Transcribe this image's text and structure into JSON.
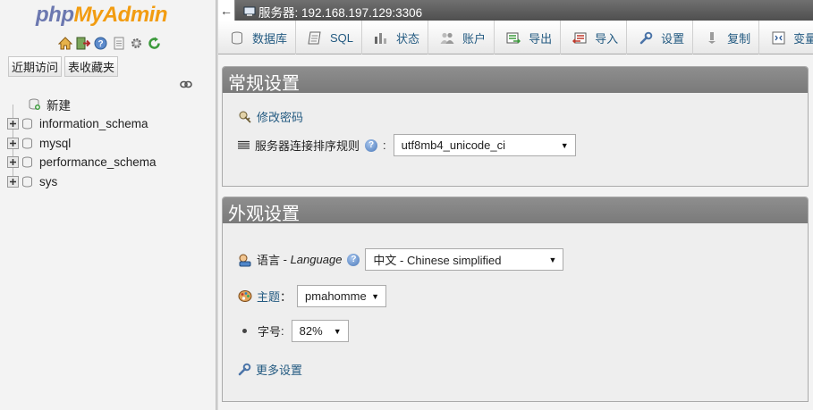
{
  "app": {
    "logo_php": "php",
    "logo_myadmin": "MyAdmin",
    "nav_icons": [
      "home-icon",
      "exit-icon",
      "help-icon",
      "docs-icon",
      "settings-icon",
      "reload-icon"
    ],
    "buttons": {
      "recent": "近期访问",
      "favorites": "表收藏夹"
    },
    "tree": [
      {
        "label": "新建",
        "kind": "new"
      },
      {
        "label": "information_schema",
        "kind": "db"
      },
      {
        "label": "mysql",
        "kind": "db"
      },
      {
        "label": "performance_schema",
        "kind": "db"
      },
      {
        "label": "sys",
        "kind": "db"
      }
    ]
  },
  "topbar": {
    "back": "←",
    "server_label": "服务器: 192.168.197.129:3306"
  },
  "tabs": [
    {
      "label": "数据库",
      "icon": "database-icon"
    },
    {
      "label": "SQL",
      "icon": "sql-icon"
    },
    {
      "label": "状态",
      "icon": "status-icon"
    },
    {
      "label": "账户",
      "icon": "accounts-icon"
    },
    {
      "label": "导出",
      "icon": "export-icon"
    },
    {
      "label": "导入",
      "icon": "import-icon"
    },
    {
      "label": "设置",
      "icon": "settings-icon"
    },
    {
      "label": "复制",
      "icon": "replication-icon"
    },
    {
      "label": "变量",
      "icon": "variables-icon"
    }
  ],
  "general": {
    "title": "常规设置",
    "change_password": "修改密码",
    "collation_label": "服务器连接排序规则",
    "collation_value": "utf8mb4_unicode_ci",
    "collation_colon": ":"
  },
  "appearance": {
    "title": "外观设置",
    "language_label": "语言",
    "language_sep": " - ",
    "language_en": "Language",
    "language_value": "中文 - Chinese simplified",
    "theme_label": "主题",
    "theme_colon": "：",
    "theme_value": "pmahomme",
    "font_label": "字号",
    "font_colon": ":",
    "font_value": "82%",
    "more_settings": "更多设置"
  },
  "colors": {
    "link": "#235a81",
    "panel_head": "#8a8a8a",
    "logo_php": "#6c78b0",
    "logo_myadmin": "#f29c11"
  }
}
